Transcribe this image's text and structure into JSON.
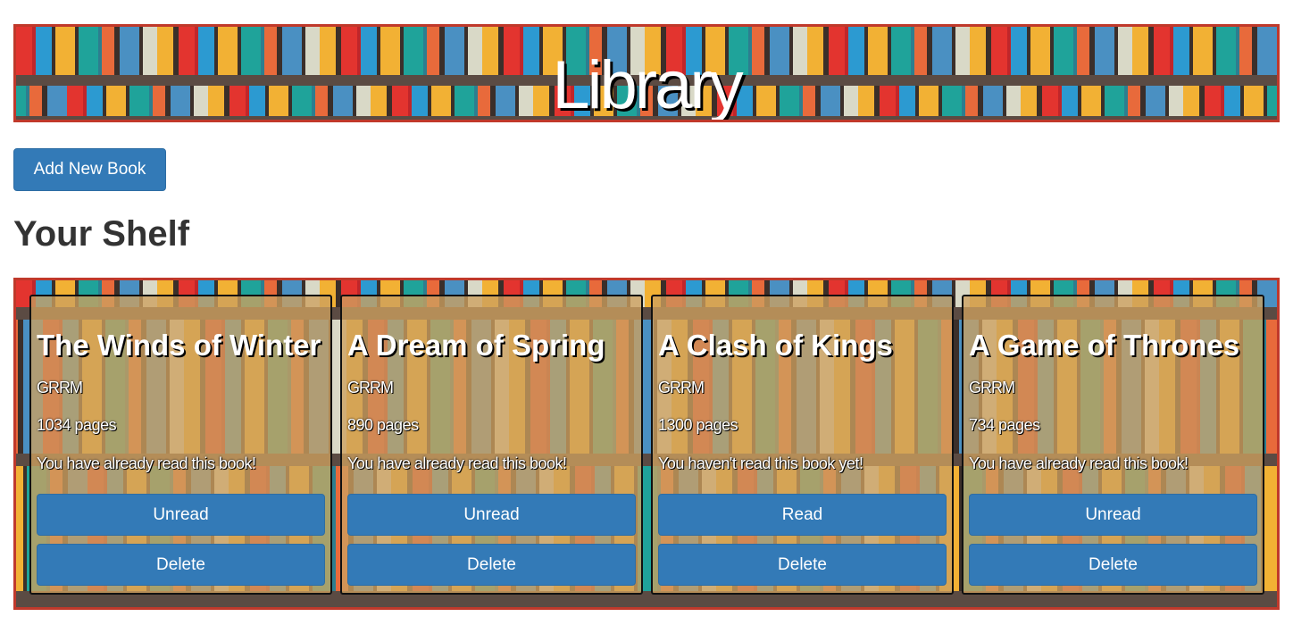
{
  "header": {
    "title": "Library"
  },
  "toolbar": {
    "add_label": "Add New Book"
  },
  "section": {
    "title": "Your Shelf"
  },
  "books": [
    {
      "title": "The Winds of Winter",
      "author": "GRRM",
      "pages": "1034 pages",
      "status": "You have already read this book!",
      "toggle_label": "Unread",
      "delete_label": "Delete"
    },
    {
      "title": "A Dream of Spring",
      "author": "GRRM",
      "pages": "890 pages",
      "status": "You have already read this book!",
      "toggle_label": "Unread",
      "delete_label": "Delete"
    },
    {
      "title": "A Clash of Kings",
      "author": "GRRM",
      "pages": "1300 pages",
      "status": "You haven't read this book yet!",
      "toggle_label": "Read",
      "delete_label": "Delete"
    },
    {
      "title": "A Game of Thrones",
      "author": "GRRM",
      "pages": "734 pages",
      "status": "You have already read this book!",
      "toggle_label": "Unread",
      "delete_label": "Delete"
    }
  ],
  "colors": {
    "primary_button": "#337ab7",
    "frame_border": "#c0392b"
  }
}
